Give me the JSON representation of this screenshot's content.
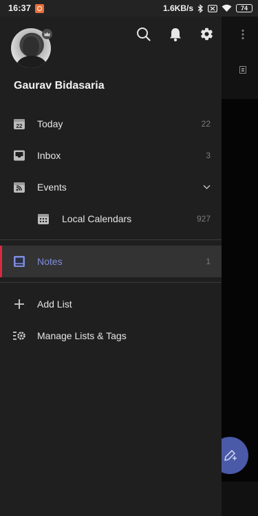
{
  "status_bar": {
    "time": "16:37",
    "speed": "1.6KB/s",
    "battery": "74"
  },
  "profile": {
    "name": "Gaurav Bidasaria"
  },
  "top_actions": {
    "icons": [
      "search-icon",
      "bell-icon",
      "gear-icon"
    ]
  },
  "menu": {
    "today": {
      "label": "Today",
      "count": "22",
      "icon": "calendar-22-icon",
      "icon_text": "22"
    },
    "inbox": {
      "label": "Inbox",
      "count": "3",
      "icon": "inbox-icon"
    },
    "events": {
      "label": "Events",
      "icon": "events-feed-icon",
      "expanded": true
    },
    "local_calendars": {
      "label": "Local Calendars",
      "count": "927",
      "icon": "calendar-grid-icon"
    },
    "notes": {
      "label": "Notes",
      "count": "1",
      "icon": "notes-icon",
      "selected": true
    },
    "add_list": {
      "label": "Add List",
      "icon": "plus-icon"
    },
    "manage": {
      "label": "Manage Lists & Tags",
      "icon": "manage-lists-icon"
    }
  },
  "colors": {
    "drawer_bg": "#1f1f1f",
    "accent": "#7f8de0",
    "active_marker": "#d8293f",
    "fab": "#4a5aa8"
  }
}
